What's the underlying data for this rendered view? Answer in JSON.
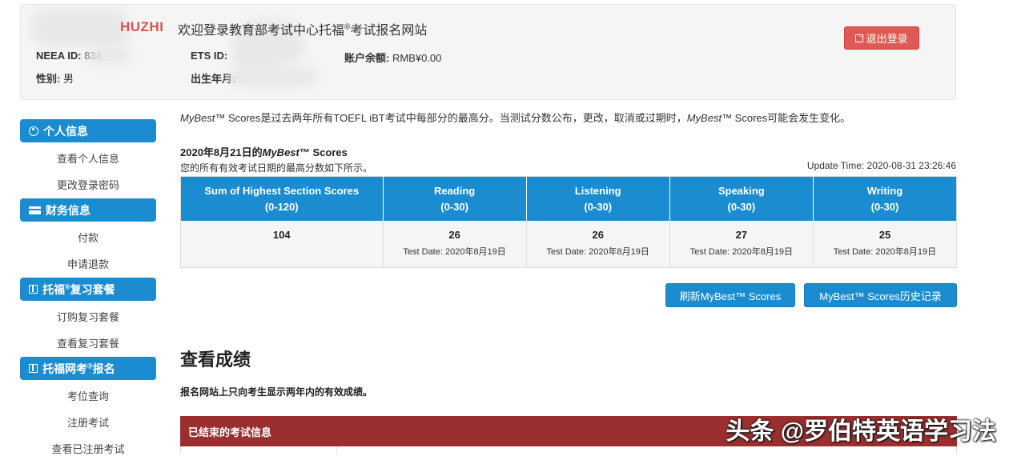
{
  "header": {
    "logo_text": "HUZHI",
    "welcome": "欢迎登录教育部考试中心托福",
    "welcome_sup": "®",
    "welcome_tail": "考试报名网站",
    "neea_label": "NEEA ID:",
    "neea_value": "834",
    "ets_label": "ETS ID:",
    "balance_label": "账户余额:",
    "balance_value": "RMB¥0.00",
    "gender_label": "性别:",
    "gender_value": "男",
    "birth_label": "出生年月:",
    "logout_label": "退出登录"
  },
  "sidebar": {
    "sections": [
      {
        "title": "个人信息",
        "icon": "user-circle-icon",
        "items": [
          "查看个人信息",
          "更改登录密码"
        ]
      },
      {
        "title": "财务信息",
        "icon": "credit-card-icon",
        "items": [
          "付款",
          "申请退款"
        ]
      },
      {
        "title": "托福",
        "title_sup": "®",
        "title_tail": "复习套餐",
        "icon": "book-icon",
        "items": [
          "订购复习套餐",
          "查看复习套餐"
        ]
      },
      {
        "title": "托福网考",
        "title_sup": "®",
        "title_tail": "报名",
        "icon": "book-icon",
        "items": [
          "考位查询",
          "注册考试",
          "查看已注册考试"
        ]
      }
    ]
  },
  "main": {
    "intro_1": "MyBest",
    "intro_2": "™ Scores是过去两年所有TOEFL iBT考试中每部分的最高分。当测试分数公布，更改，取消或过期时，",
    "intro_3": "MyBest",
    "intro_4": "™ Scores可能会发生变化。",
    "scores_date": "2020年8月21日的",
    "scores_date_brand": "MyBest",
    "scores_date_tail": "™ Scores",
    "scores_sub": "您的所有有效考试日期的最高分数如下所示。",
    "update_time": "Update Time: 2020-08-31 23:26:46",
    "table_headers": [
      {
        "line1": "Sum of Highest Section Scores",
        "line2": "(0-120)"
      },
      {
        "line1": "Reading",
        "line2": "(0-30)"
      },
      {
        "line1": "Listening",
        "line2": "(0-30)"
      },
      {
        "line1": "Speaking",
        "line2": "(0-30)"
      },
      {
        "line1": "Writing",
        "line2": "(0-30)"
      }
    ],
    "table_values": [
      {
        "score": "104",
        "date": ""
      },
      {
        "score": "26",
        "date": "Test Date: 2020年8月19日"
      },
      {
        "score": "26",
        "date": "Test Date: 2020年8月19日"
      },
      {
        "score": "27",
        "date": "Test Date: 2020年8月19日"
      },
      {
        "score": "25",
        "date": "Test Date: 2020年8月19日"
      }
    ],
    "refresh_button": "刷新MyBest™ Scores",
    "history_button": "MyBest™ Scores历史记录",
    "section_title": "查看成绩",
    "section_sub": "报名网站上只向考生显示两年内的有效成绩。",
    "finished_bar": "已结束的考试信息"
  },
  "watermark": "头条 @罗伯特英语学习法",
  "colors": {
    "primary": "#1a8ccf",
    "danger": "#e05a55",
    "finished_bar": "#9b2f2f"
  }
}
